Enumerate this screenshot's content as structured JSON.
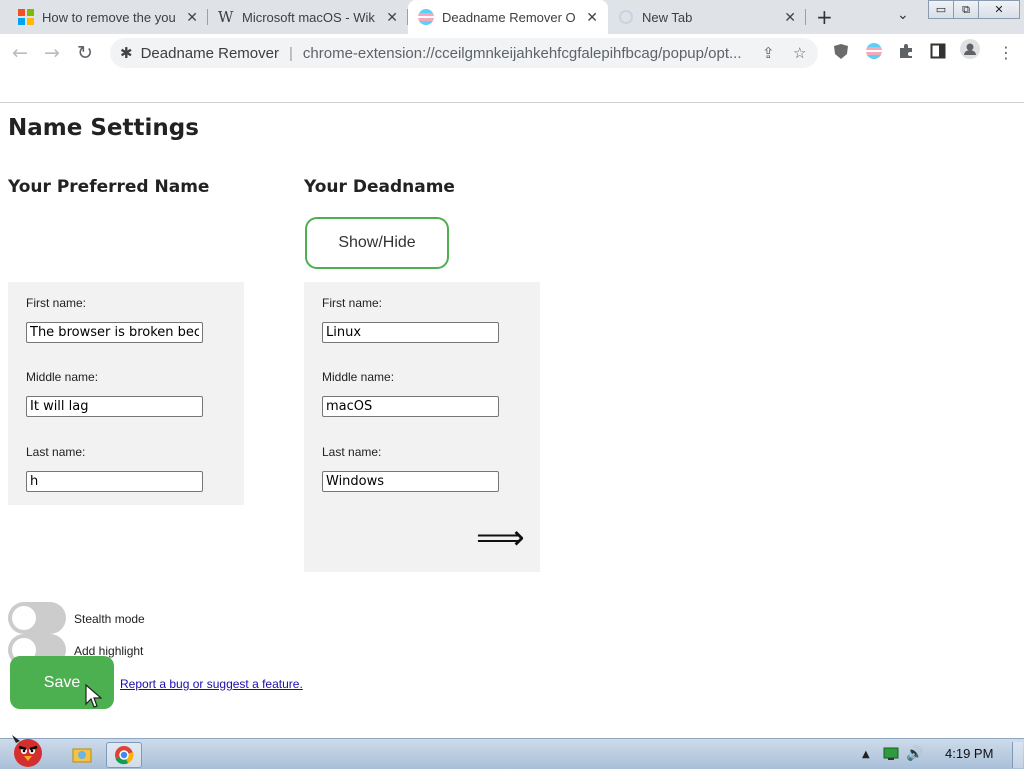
{
  "browser": {
    "tabs": [
      {
        "title": "How to remove the you",
        "icon": "microsoft-icon"
      },
      {
        "title": "Microsoft macOS - Wik",
        "icon": "wikipedia-icon"
      },
      {
        "title": "Deadname Remover Op",
        "icon": "trans-flag-icon",
        "active": true
      },
      {
        "title": "New Tab",
        "icon": "loading-icon"
      }
    ],
    "wiki_icon_glyph": "W",
    "new_tab_glyph": "+",
    "tab_dropdown_glyph": "⌄",
    "close_glyph": "✕",
    "window_controls": {
      "minimize": "▭",
      "restore": "⧉",
      "close": "✕"
    },
    "address": {
      "site_name": "Deadname Remover",
      "url": "chrome-extension://cceilgmnkeijahkehfcgfalepihfbcag/popup/opt..."
    }
  },
  "page": {
    "title": "Name Settings",
    "preferred_heading": "Your Preferred Name",
    "deadname_heading": "Your Deadname",
    "show_hide_label": "Show/Hide",
    "labels": {
      "first": "First name:",
      "middle": "Middle name:",
      "last": "Last name:"
    },
    "preferred": {
      "first": "The browser is broken because",
      "middle": "It will lag",
      "last": "h"
    },
    "deadname": {
      "first": "Linux",
      "middle": "macOS",
      "last": "Windows"
    },
    "arrow_glyph": "⟹",
    "toggles": [
      {
        "label": "Stealth mode",
        "on": false
      },
      {
        "label": "Add highlight",
        "on": false
      }
    ],
    "save_label": "Save",
    "report_link": "Report a bug or suggest a feature."
  },
  "taskbar": {
    "clock": "4:19 PM"
  },
  "colors": {
    "accent": "#4caf50",
    "link": "#1a0dab",
    "panel": "#f2f2f2"
  }
}
